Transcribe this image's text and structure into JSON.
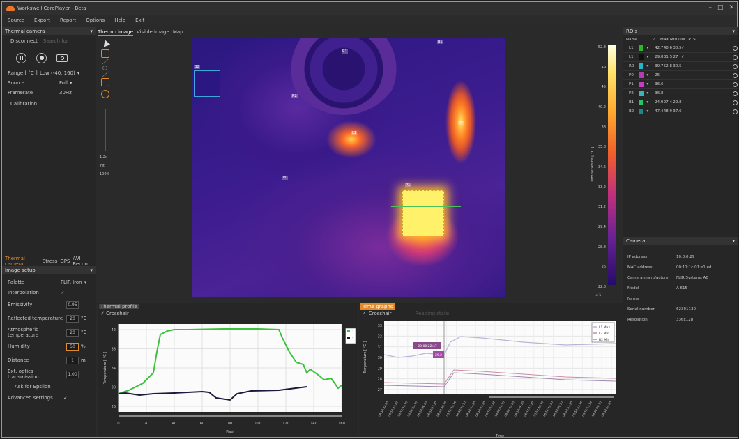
{
  "window": {
    "title": "Workswell CorePlayer - Beta",
    "controls": [
      "–",
      "□",
      "✕"
    ]
  },
  "menu": [
    "Source",
    "Export",
    "Report",
    "Options",
    "Help",
    "Exit"
  ],
  "left_panel": {
    "title": "Thermal camera",
    "disconnect": "Disconnect",
    "search_note": "Search for",
    "range_label": "Range [ °C ]",
    "range_value": "Low (-40..160)",
    "source_label": "Source",
    "source_value": "Full",
    "framerate_label": "Framerate",
    "framerate_value": "30Hz",
    "calibration": "Calibration",
    "tabs": [
      "Thermal camera",
      "Stress",
      "GPS",
      "AVI Record"
    ],
    "image_setup": "Image setup",
    "palette_label": "Palette",
    "palette_value": "FLIR Iron",
    "interpolation_label": "Interpolation",
    "interpolation_value": "✓",
    "emissivity_label": "Emissivity",
    "emissivity_value": "0.95",
    "refl_label": "Reflected temperature",
    "refl_value": "20",
    "refl_unit": "°C",
    "atm_label": "Atmospheric temperature",
    "atm_value": "20",
    "atm_unit": "°C",
    "humidity_label": "Humidity",
    "humidity_value": "50",
    "humidity_unit": "%",
    "distance_label": "Distance",
    "distance_value": "1",
    "distance_unit": "m",
    "optics_label": "Ext. optics transmission",
    "optics_value": "1.00",
    "ask_label": "Ask for Epsilon",
    "advanced_label": "Advanced settings",
    "advanced_value": "✓"
  },
  "main_tabs": [
    "Thermo image",
    "Visible image",
    "Map"
  ],
  "zoom": {
    "values": [
      "1,2x",
      "Fit",
      "100%"
    ]
  },
  "scale": {
    "label": "Temperature [ °C ]",
    "ticks": [
      "52.8",
      "49",
      "45",
      "40.2",
      "38",
      "35.8",
      "34.6",
      "33.2",
      "31.2",
      "29.4",
      "28.8",
      "26",
      "22.8"
    ],
    "footer": "◄ 1"
  },
  "roi_tags": [
    "R1",
    "R2",
    "L1",
    "P0",
    "P1",
    "P2",
    "B1",
    "B2"
  ],
  "rois": {
    "title": "ROIs",
    "headers": [
      "Name",
      "Ø",
      "MAX",
      "MIN",
      "LIM",
      "TP",
      "SC"
    ],
    "rows": [
      {
        "name": "L1",
        "color": "#2db52d",
        "avg": "42.7",
        "max": "48.6",
        "min": "30.5",
        "lim": "✓",
        "tp": ""
      },
      {
        "name": "L1",
        "color": "#101010",
        "avg": "29.8",
        "max": "31.5",
        "min": "27",
        "lim": "✓",
        "tp": ""
      },
      {
        "name": "R0",
        "color": "#24b7c4",
        "avg": "39.7",
        "max": "52.8",
        "min": "30.5",
        "lim": "",
        "tp": ""
      },
      {
        "name": "P0",
        "color": "#b43ab6",
        "avg": "25",
        "max": "-",
        "min": "-",
        "lim": "",
        "tp": ""
      },
      {
        "name": "P1",
        "color": "#c83ac8",
        "avg": "36.6",
        "max": "-",
        "min": "-",
        "lim": "",
        "tp": ""
      },
      {
        "name": "P2",
        "color": "#3ab4b4",
        "avg": "36.8",
        "max": "-",
        "min": "-",
        "lim": "",
        "tp": ""
      },
      {
        "name": "B1",
        "color": "#2bc46a",
        "avg": "24.9",
        "max": "27.4",
        "min": "22.8",
        "lim": "",
        "tp": ""
      },
      {
        "name": "B2",
        "color": "#1a8a8a",
        "avg": "47.4",
        "max": "48.9",
        "min": "37.6",
        "lim": "",
        "tp": ""
      }
    ]
  },
  "camera_info": {
    "title": "Camera",
    "items": [
      {
        "k": "IP address",
        "v": "10.0.0.29"
      },
      {
        "k": "MAC address",
        "v": "00:11:1c:01:e1:ed"
      },
      {
        "k": "Camera manufacturer",
        "v": "FLIR Systems AB"
      },
      {
        "k": "Model",
        "v": "A 615"
      },
      {
        "k": "Name",
        "v": ""
      },
      {
        "k": "Serial number",
        "v": "62301130"
      },
      {
        "k": "Resolution",
        "v": "336x128"
      }
    ]
  },
  "thermal_profile": {
    "tab": "Thermal profile",
    "cross": "Crosshair",
    "xlabel": "Pixel",
    "ylabel": "Temperature [ °C ]",
    "legend": [
      "L1",
      "L2"
    ],
    "xticks": [
      "0",
      "20",
      "40",
      "60",
      "80",
      "100",
      "120",
      "140",
      "160"
    ],
    "yticks": [
      "26",
      "30",
      "34",
      "38",
      "42"
    ]
  },
  "time_graphs": {
    "tab": "Time graphs",
    "cross": "Crosshair",
    "secondary": "Reading state",
    "xlabel": "Time",
    "ylabel": "Temperature [ °C ]",
    "legend": [
      "L1 Max",
      "L2 Min",
      "B2 Min"
    ],
    "tooltip": "00:00:22:47",
    "tooltip2": "29.2",
    "yticks": [
      "27",
      "28",
      "29",
      "30",
      "31",
      "32",
      "33"
    ],
    "xticks": [
      "08:58:32:10",
      "08:58:33:10",
      "08:58:34:10",
      "08:58:35:10",
      "08:58:36:10",
      "08:58:37:10",
      "08:58:38:10",
      "08:58:39:10",
      "08:58:40:10",
      "08:58:41:10",
      "08:58:42:10",
      "08:58:43:10",
      "08:58:44:10",
      "08:58:45:10",
      "08:58:46:10",
      "08:58:47:10",
      "08:58:48:10",
      "08:58:49:10",
      "08:58:50:10",
      "08:58:51:10",
      "08:58:52:10",
      "08:58:53:10",
      "08:58:54:10",
      "08:58:55:10"
    ]
  }
}
